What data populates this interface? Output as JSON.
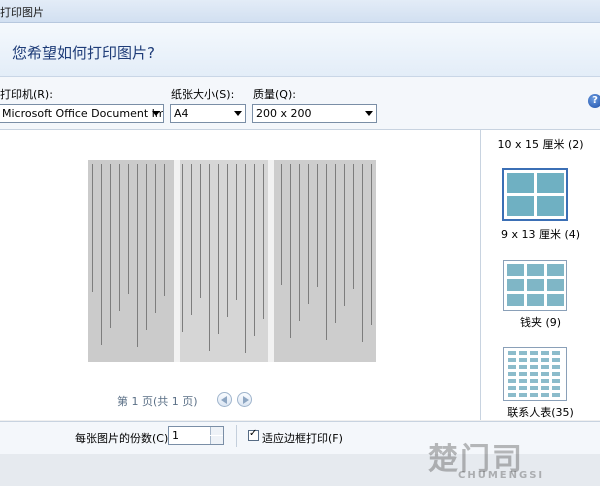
{
  "window": {
    "title": "打印图片"
  },
  "header": {
    "question": "您希望如何打印图片?"
  },
  "toolbar": {
    "printer_label": "打印机(R):",
    "printer_value": "Microsoft Office Document Im",
    "paper_label": "纸张大小(S):",
    "paper_value": "A4",
    "quality_label": "质量(Q):",
    "quality_value": "200 x 200",
    "help_glyph": "?"
  },
  "preview": {
    "page_status": "第 1 页(共 1 页)"
  },
  "layouts": {
    "items": [
      {
        "label": "10 x 15 厘米 (2)"
      },
      {
        "label": "9 x 13 厘米 (4)"
      },
      {
        "label": "钱夹 (9)"
      },
      {
        "label": "联系人表(35)"
      }
    ],
    "selected_index": 1
  },
  "bottom": {
    "copies_label": "每张图片的份数(C):",
    "copies_value": "1",
    "fit_label": "适应边框打印(F)",
    "fit_checked": true
  },
  "watermark": {
    "main": "楚门司",
    "sub": "CHUMENGSI"
  },
  "colors": {
    "accent": "#3b6fb5",
    "header_text": "#1e3c78"
  }
}
